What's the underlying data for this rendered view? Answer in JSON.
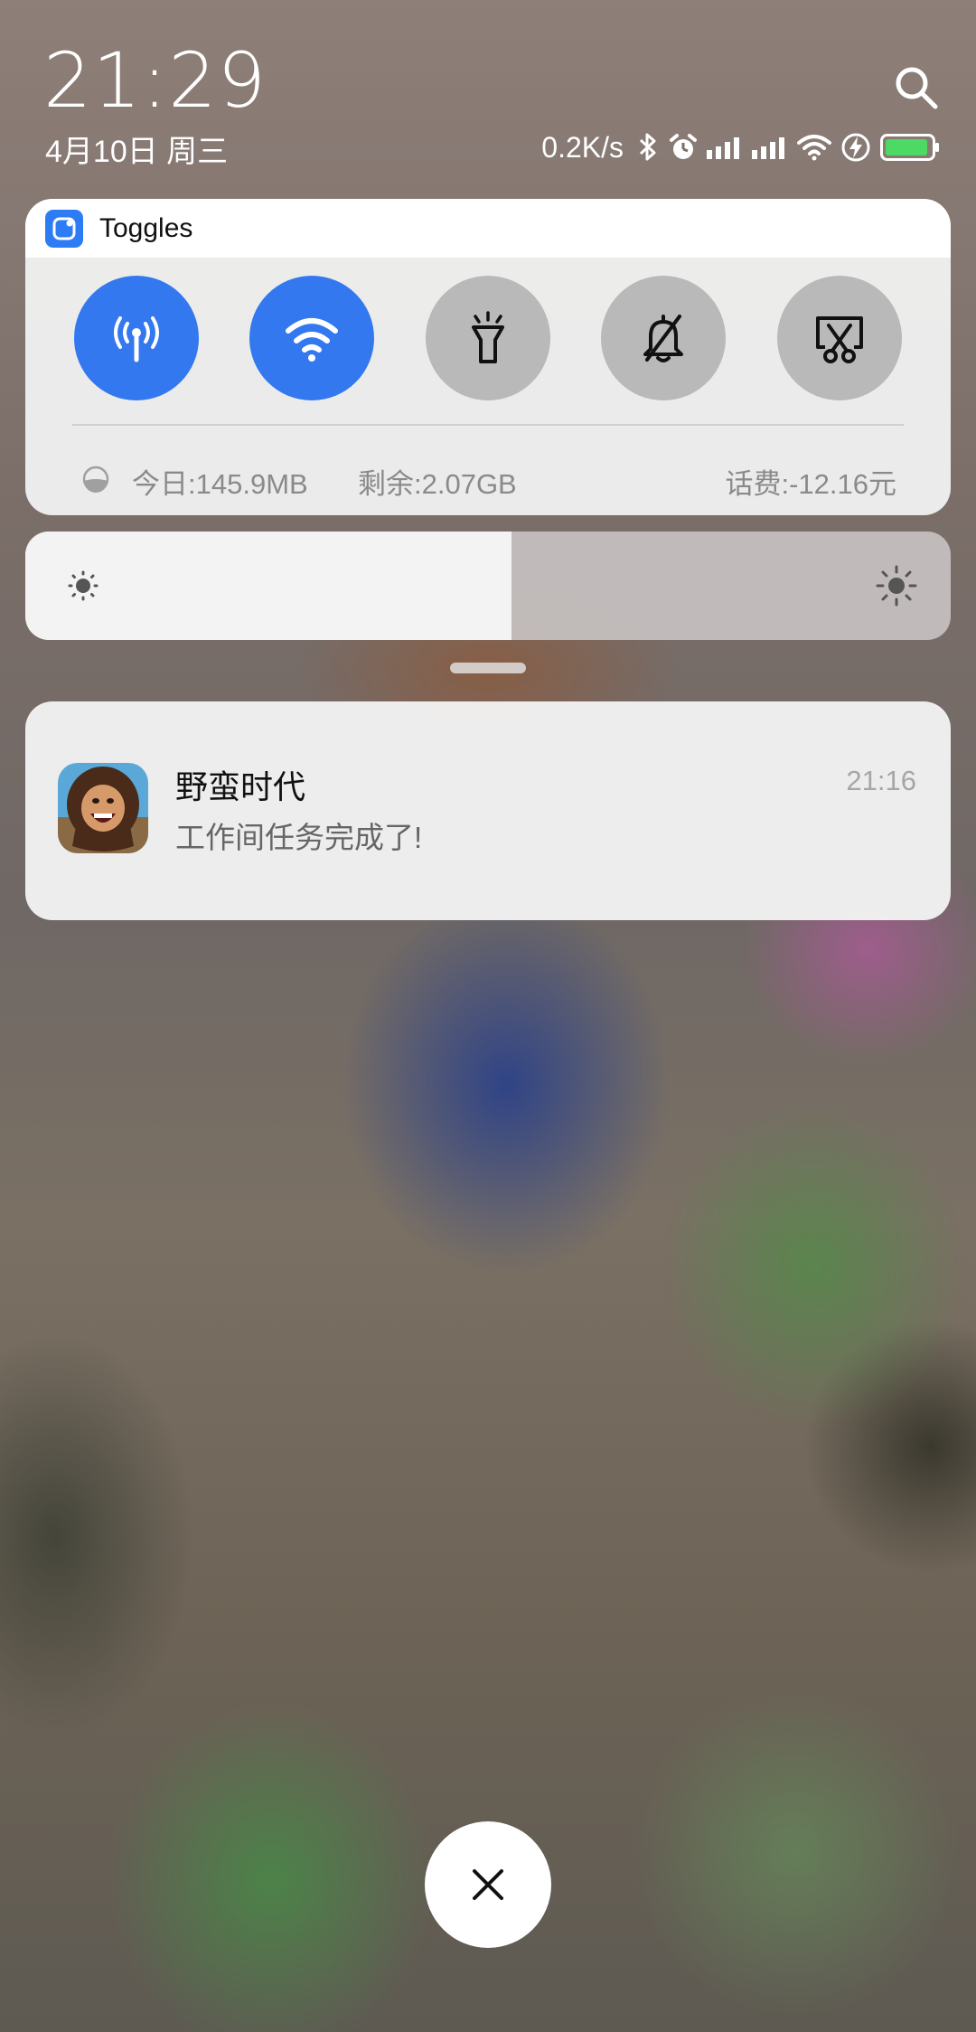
{
  "status": {
    "time": "21:29",
    "date": "4月10日 周三",
    "network_speed": "0.2K/s",
    "battery_color": "#4cd964",
    "icons": [
      "bluetooth-icon",
      "alarm-icon",
      "signal-icon",
      "signal-icon",
      "wifi-icon",
      "charging-icon",
      "battery-icon"
    ]
  },
  "toggles": {
    "title": "Toggles",
    "accent": "#3478f0",
    "items": [
      {
        "name": "mobile-data",
        "icon": "antenna-icon",
        "on": true
      },
      {
        "name": "wifi",
        "icon": "wifi-icon",
        "on": true
      },
      {
        "name": "flashlight",
        "icon": "flashlight-icon",
        "on": false
      },
      {
        "name": "mute",
        "icon": "bell-off-icon",
        "on": false
      },
      {
        "name": "screenshot",
        "icon": "screenshot-icon",
        "on": false
      }
    ],
    "usage": {
      "today": "今日:145.9MB",
      "remaining": "剩余:2.07GB",
      "balance": "话费:-12.16元"
    }
  },
  "brightness": {
    "level": 0.525
  },
  "notification": {
    "app_icon": "caveman-app-icon",
    "title": "野蛮时代",
    "body": "工作间任务完成了!",
    "time": "21:16"
  }
}
